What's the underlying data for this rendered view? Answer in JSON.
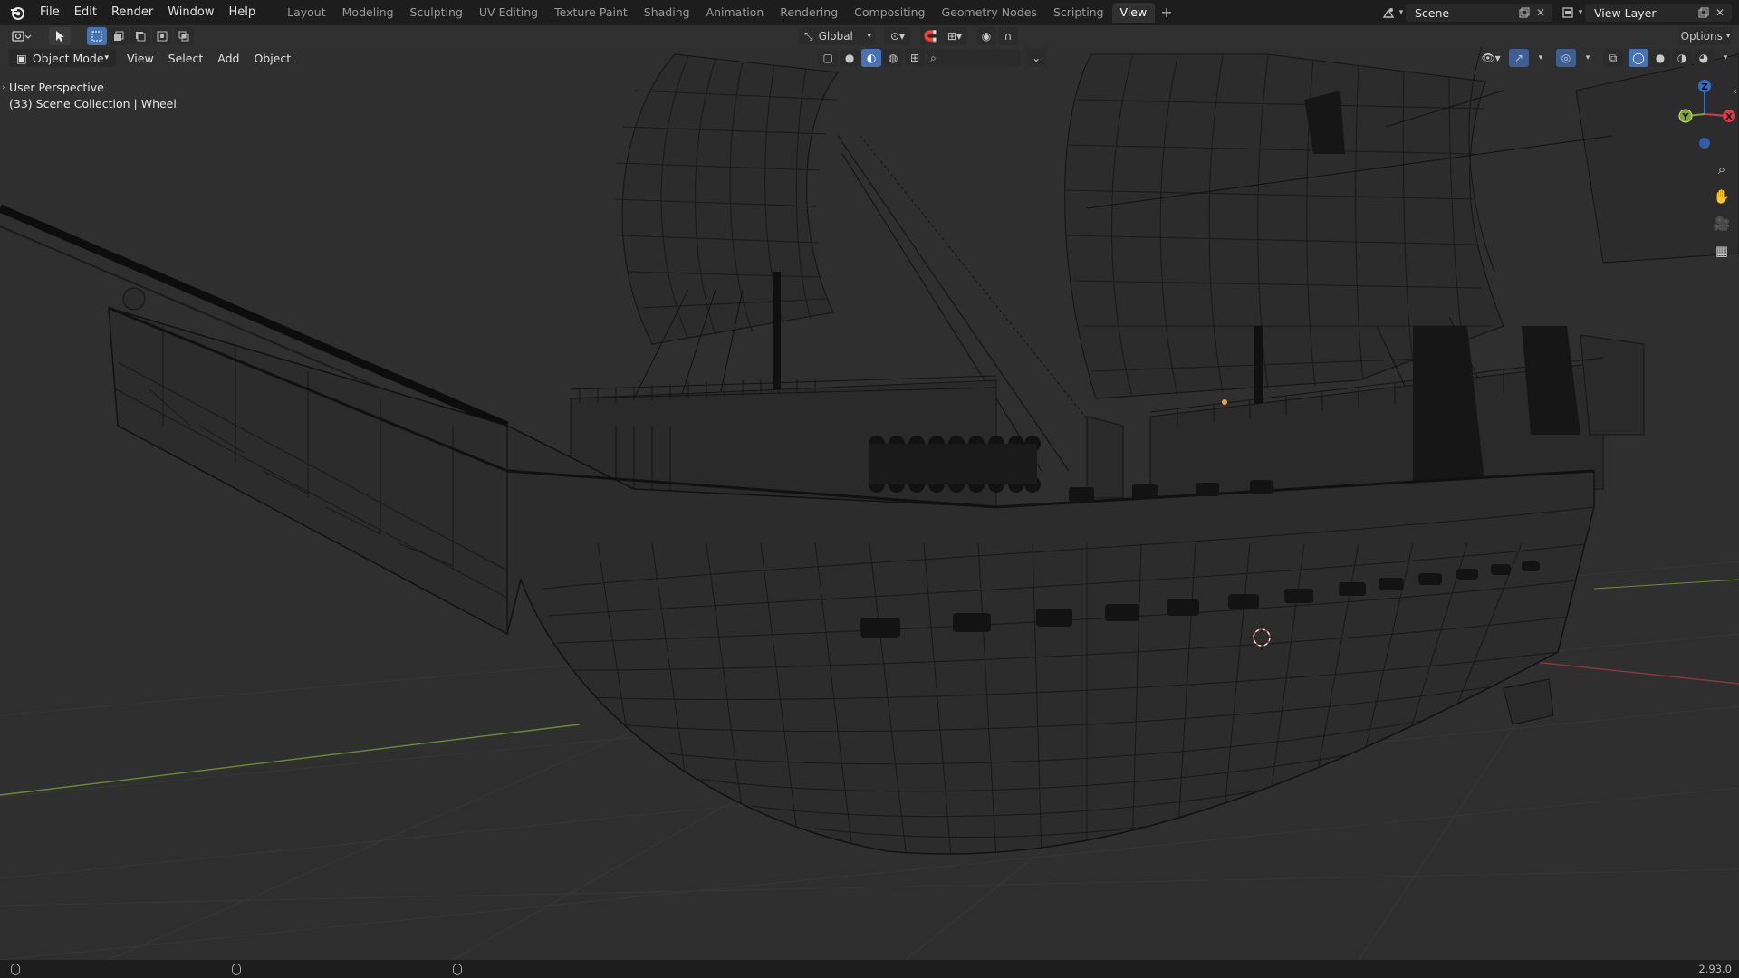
{
  "menu": [
    "File",
    "Edit",
    "Render",
    "Window",
    "Help"
  ],
  "workspaces": [
    "Layout",
    "Modeling",
    "Sculpting",
    "UV Editing",
    "Texture Paint",
    "Shading",
    "Animation",
    "Rendering",
    "Compositing",
    "Geometry Nodes",
    "Scripting",
    "View"
  ],
  "active_workspace": "View",
  "scene": {
    "label": "Scene"
  },
  "view_layer": {
    "label": "View Layer"
  },
  "toolheader": {
    "transform_orientation": "Global",
    "options_label": "Options"
  },
  "viewport_header": {
    "mode": "Object Mode",
    "menus": [
      "View",
      "Select",
      "Add",
      "Object"
    ]
  },
  "overlay": {
    "perspective": "User Perspective",
    "collection": "(33) Scene Collection | Wheel"
  },
  "gizmo": {
    "axes": [
      {
        "name": "Z",
        "color": "#2f6fd1"
      },
      {
        "name": "X",
        "color": "#d63b4b"
      },
      {
        "name": "Y",
        "color": "#7fa63a"
      }
    ]
  },
  "status": {
    "version": "2.93.0"
  },
  "colors": {
    "accent": "#4772b3",
    "x_axis": "#d63b4b",
    "y_axis": "#7fa63a",
    "z_axis": "#2f6fd1",
    "wire": "#0f0f0f"
  }
}
